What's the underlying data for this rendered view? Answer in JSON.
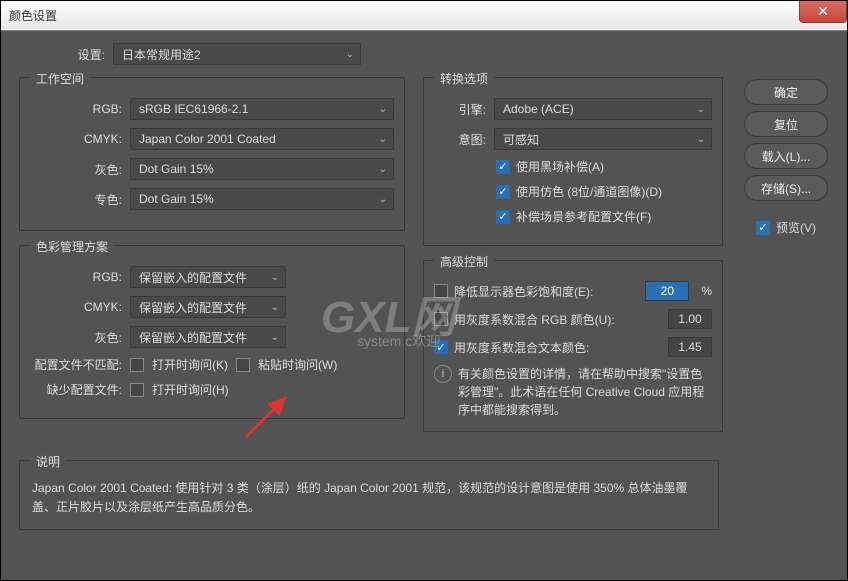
{
  "window": {
    "title": "颜色设置"
  },
  "top": {
    "settings_label": "设置:",
    "settings_value": "日本常规用途2"
  },
  "buttons": {
    "ok": "确定",
    "reset": "复位",
    "load": "载入(L)...",
    "save": "存储(S)...",
    "preview_label": "预览(V)"
  },
  "workspace": {
    "title": "工作空间",
    "rgb_label": "RGB:",
    "rgb_value": "sRGB IEC61966-2.1",
    "cmyk_label": "CMYK:",
    "cmyk_value": "Japan Color 2001 Coated",
    "gray_label": "灰色:",
    "gray_value": "Dot Gain 15%",
    "spot_label": "专色:",
    "spot_value": "Dot Gain 15%"
  },
  "policies": {
    "title": "色彩管理方案",
    "rgb_label": "RGB:",
    "rgb_value": "保留嵌入的配置文件",
    "cmyk_label": "CMYK:",
    "cmyk_value": "保留嵌入的配置文件",
    "gray_label": "灰色:",
    "gray_value": "保留嵌入的配置文件",
    "mismatch_label": "配置文件不匹配:",
    "ask_open": "打开时询问(K)",
    "ask_paste": "粘贴时询问(W)",
    "missing_label": "缺少配置文件:",
    "ask_open2": "打开时询问(H)"
  },
  "conversion": {
    "title": "转换选项",
    "engine_label": "引擎:",
    "engine_value": "Adobe (ACE)",
    "intent_label": "意图:",
    "intent_value": "可感知",
    "blackpoint": "使用黑场补偿(A)",
    "dither": "使用仿色 (8位/通道图像)(D)",
    "compensate": "补偿场景参考配置文件(F)"
  },
  "advanced": {
    "title": "高级控制",
    "desat_label": "降低显示器色彩饱和度(E):",
    "desat_value": "20",
    "desat_unit": "%",
    "blend_rgb_label": "用灰度系数混合 RGB 颜色(U):",
    "blend_rgb_value": "1.00",
    "blend_text_label": "用灰度系数混合文本颜色:",
    "blend_text_value": "1.45",
    "info": "有关颜色设置的详情，请在帮助中搜索\"设置色彩管理\"。此术语在任何 Creative Cloud 应用程序中都能搜索得到。"
  },
  "description": {
    "title": "说明",
    "text": "Japan Color 2001 Coated:  使用针对 3 类（涂层）纸的 Japan Color 2001 规范，该规范的设计意图是使用 350%  总体油墨覆盖、正片胶片以及涂层纸产生高品质分色。"
  },
  "watermark": {
    "big": "GXL网",
    "small": "system.c欢迎"
  }
}
